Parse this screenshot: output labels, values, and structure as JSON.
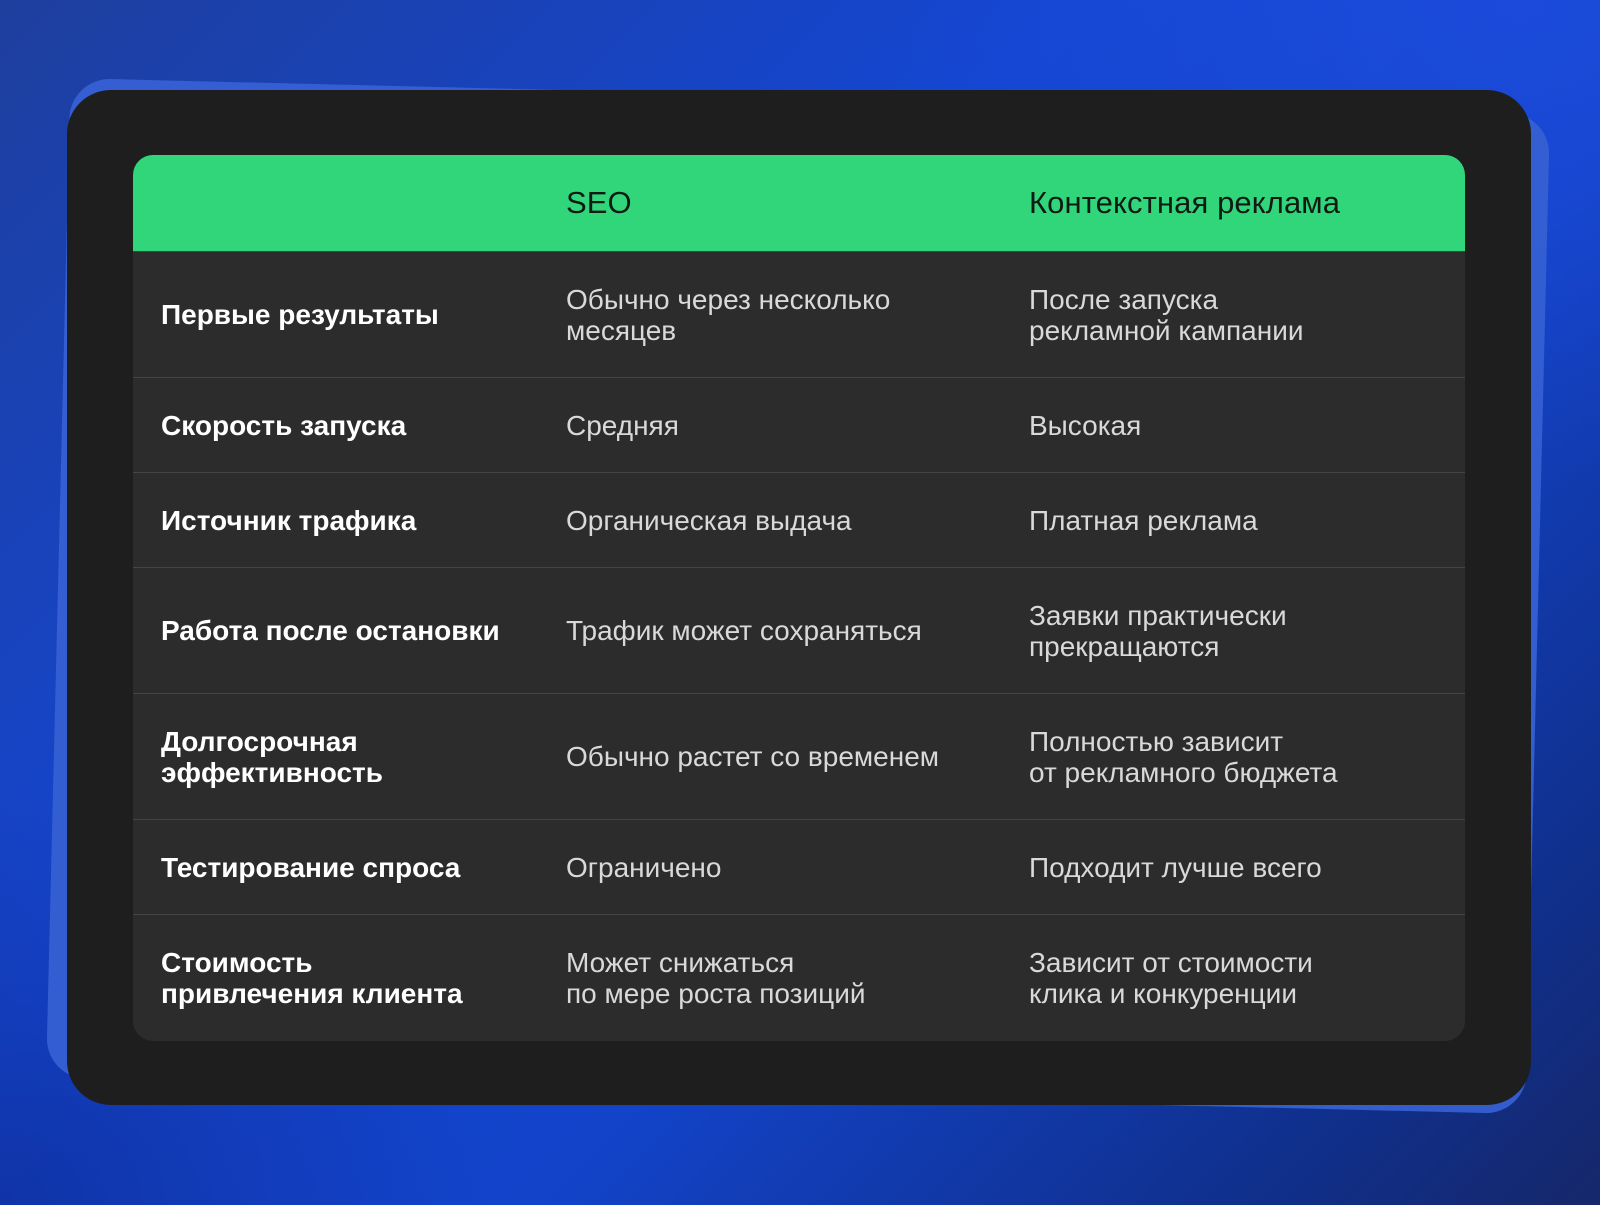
{
  "table": {
    "headers": [
      "",
      "SEO",
      "Контекстная реклама"
    ],
    "rows": [
      {
        "label": "Первые результаты",
        "seo": "Обычно через несколько\nмесяцев",
        "ppc": "После запуска\nрекламной кампании"
      },
      {
        "label": "Скорость запуска",
        "seo": "Средняя",
        "ppc": "Высокая"
      },
      {
        "label": "Источник трафика",
        "seo": "Органическая выдача",
        "ppc": "Платная реклама"
      },
      {
        "label": "Работа после остановки",
        "seo": "Трафик может сохраняться",
        "ppc": "Заявки практически\nпрекращаются"
      },
      {
        "label": "Долгосрочная\nэффективность",
        "seo": "Обычно растет со временем",
        "ppc": "Полностью зависит\nот рекламного бюджета"
      },
      {
        "label": "Тестирование спроса",
        "seo": "Ограничено",
        "ppc": "Подходит лучше всего"
      },
      {
        "label": "Стоимость\nпривлечения клиента",
        "seo": "Может снижаться\nпо мере роста позиций",
        "ppc": "Зависит от стоимости\nклика и конкуренции"
      }
    ]
  },
  "colors": {
    "background": "#1446d2",
    "card": "#1e1e1e",
    "table_body": "#2c2c2c",
    "header_accent": "#30d679",
    "divider": "#444444"
  }
}
